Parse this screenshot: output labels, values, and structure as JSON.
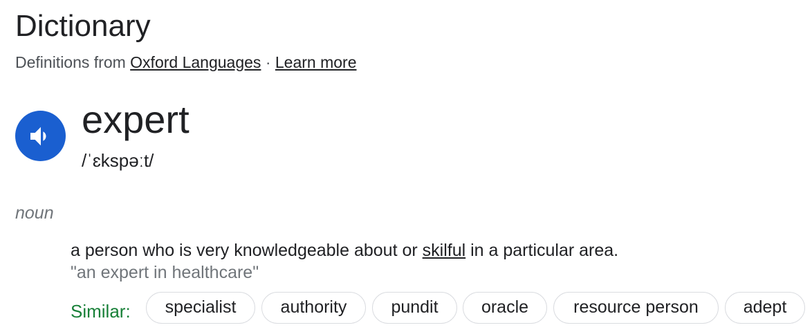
{
  "header": {
    "title": "Dictionary",
    "source_prefix": "Definitions from",
    "source_link": "Oxford Languages",
    "separator": "·",
    "learn_more": "Learn more"
  },
  "entry": {
    "word": "expert",
    "phonetic": "/ˈɛkspəːt/",
    "speaker_icon": "volume-up-icon",
    "part_of_speech": "noun",
    "definition_before": "a person who is very knowledgeable about or ",
    "definition_link": "skilful",
    "definition_after": " in a particular area.",
    "example": "\"an expert in healthcare\"",
    "similar_label": "Similar:",
    "similar": [
      "specialist",
      "authority",
      "pundit",
      "oracle",
      "resource person",
      "adept"
    ]
  },
  "colors": {
    "speaker_bg": "#1a5fd0",
    "similar_label": "#188038",
    "muted_text": "#70757a"
  }
}
